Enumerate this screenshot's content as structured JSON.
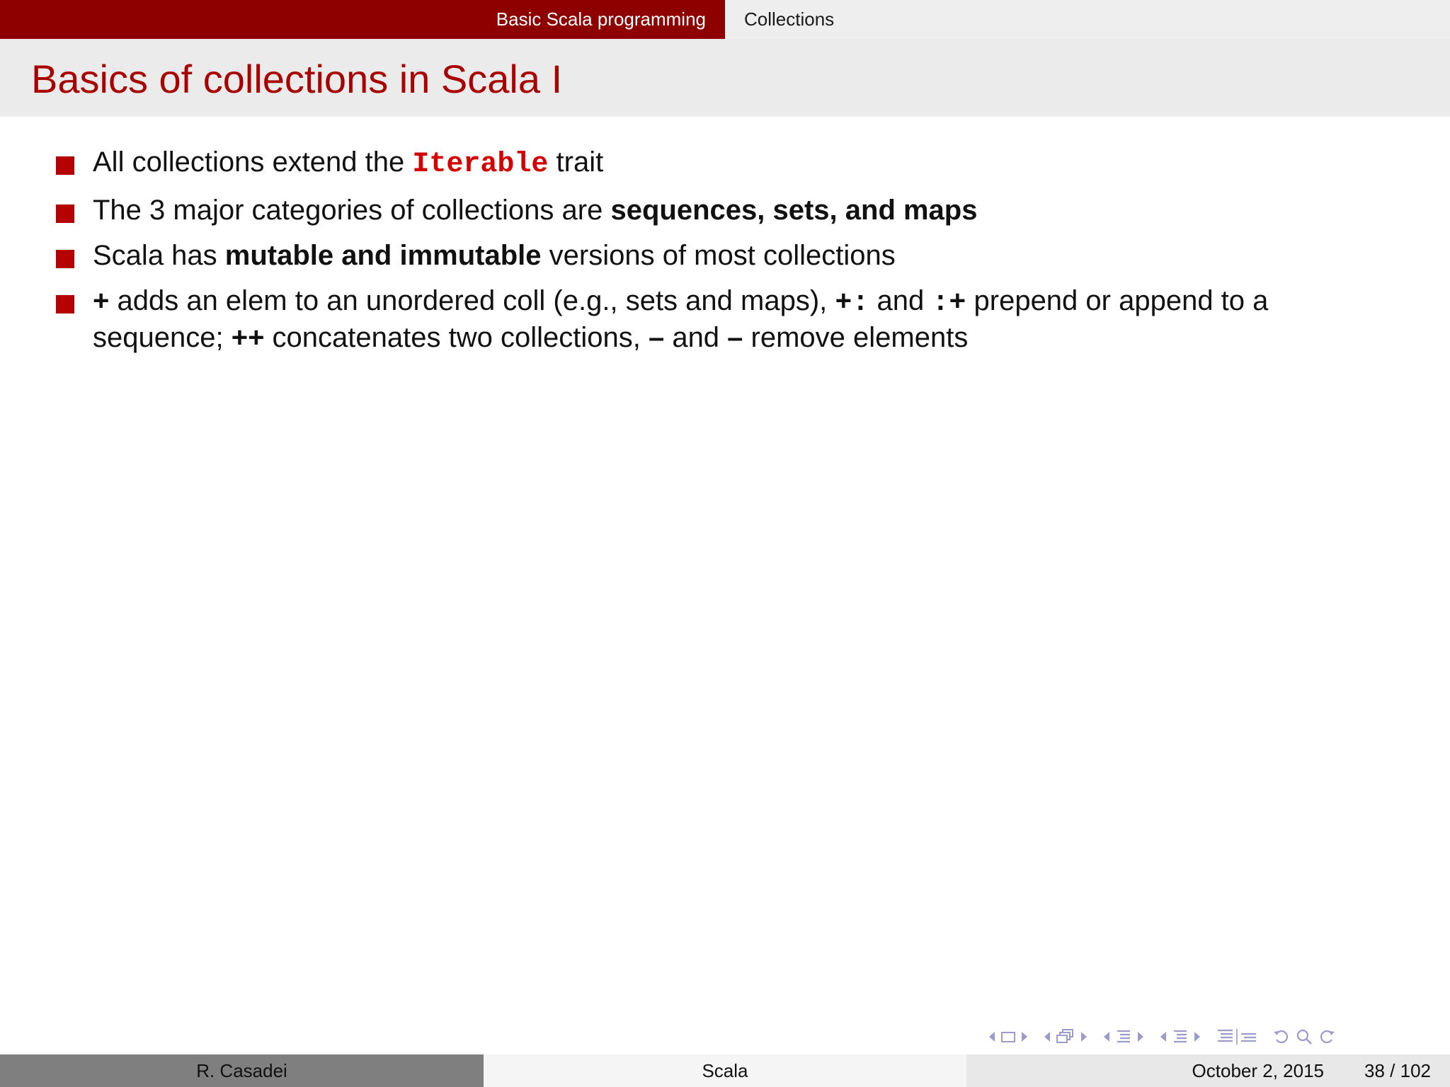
{
  "header": {
    "section": "Basic Scala programming",
    "subsection": "Collections"
  },
  "frame": {
    "title": "Basics of collections in Scala I"
  },
  "bullets": {
    "b1": {
      "pre": "All collections extend the ",
      "code": "Iterable",
      "post": " trait"
    },
    "b2": {
      "pre": "The 3 major categories of collections are ",
      "bold": "sequences, sets, and maps"
    },
    "b3": {
      "pre": "Scala has ",
      "bold": "mutable and immutable",
      "post": " versions of most collections"
    },
    "b4": {
      "op_plus": "+",
      "t1": " adds an elem to an unordered coll (e.g., sets and maps), ",
      "op_prepend": "+:",
      "t2": " and ",
      "op_append": ":+",
      "t3": " prepend or append to a sequence; ",
      "op_concat": "++",
      "t4": " concatenates two collections, ",
      "op_minus1": "–",
      "t5": " and ",
      "op_minus2": "–",
      "t6": " remove elements"
    }
  },
  "colors": {
    "header_left_bg": "#8e0000",
    "title_color": "#a80000",
    "bullet_color": "#b40000",
    "code_color": "#d40000",
    "nav_symbol_color": "#9b9bcc"
  },
  "nav_icons": [
    "arrow-left-icon",
    "frame-icon",
    "arrow-right-icon",
    "arrow-left-icon",
    "subsection-icon",
    "arrow-right-icon",
    "arrow-left-icon",
    "section-icon",
    "arrow-right-icon",
    "arrow-left-icon",
    "subsection-list-icon",
    "arrow-right-icon",
    "toc-icon",
    "search-icon",
    "undo-icon",
    "redo-icon"
  ],
  "footer": {
    "author": "R. Casadei",
    "short_title": "Scala",
    "date": "October 2, 2015",
    "page": "38 / 102"
  }
}
